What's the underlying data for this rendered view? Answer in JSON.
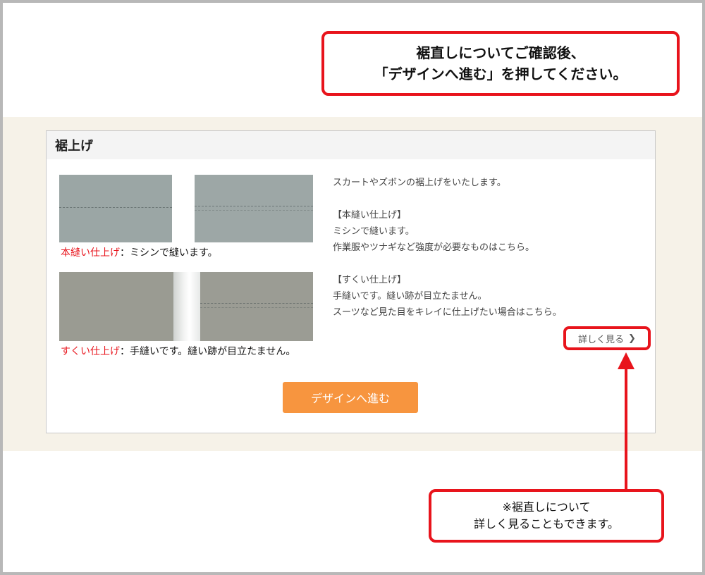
{
  "callouts": {
    "top_line1": "裾直しについてご確認後、",
    "top_line2": "「デザインへ進む」を押してください。",
    "bottom_line1": "※裾直しについて",
    "bottom_line2": "詳しく見ることもできます。"
  },
  "panel": {
    "title": "裾上げ",
    "caption_a_red": "本縫い仕上げ",
    "caption_a_rest": "：ミシンで縫います。",
    "caption_b_red": "すくい仕上げ",
    "caption_b_rest": "：手縫いです。縫い跡が目立たません。",
    "desc_intro": "スカートやズボンの裾上げをいたします。",
    "desc_hon_title": "【本縫い仕上げ】",
    "desc_hon_1": "ミシンで縫います。",
    "desc_hon_2": "作業服やツナギなど強度が必要なものはこちら。",
    "desc_sukui_title": "【すくい仕上げ】",
    "desc_sukui_1": "手縫いです。縫い跡が目立たません。",
    "desc_sukui_2": "スーツなど見た目をキレイに仕上げたい場合はこちら。",
    "more_link": "詳しく見る",
    "design_button": "デザインへ進む"
  },
  "colors": {
    "accent_red": "#e8141c",
    "button_orange": "#f7953f",
    "band_bg": "#f6f2e8"
  }
}
